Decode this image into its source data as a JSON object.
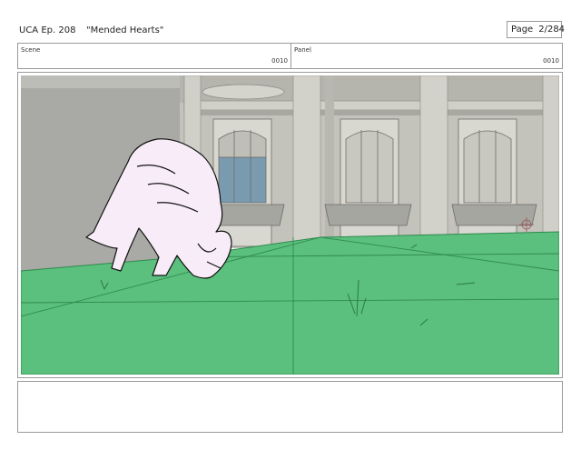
{
  "header": {
    "episode": "UCA Ep. 208",
    "title": "\"Mended Hearts\"",
    "page_label": "Page",
    "page_number": "2/284"
  },
  "scene": {
    "label": "Scene",
    "number": "0010"
  },
  "panel": {
    "label": "Panel",
    "number": "0010"
  },
  "colors": {
    "ground": "#5cbf7e",
    "wall": "#a8a8a4",
    "building": "#c4c4bc",
    "sketch_fill": "#f8ecf8"
  },
  "notes": {
    "text": ""
  }
}
